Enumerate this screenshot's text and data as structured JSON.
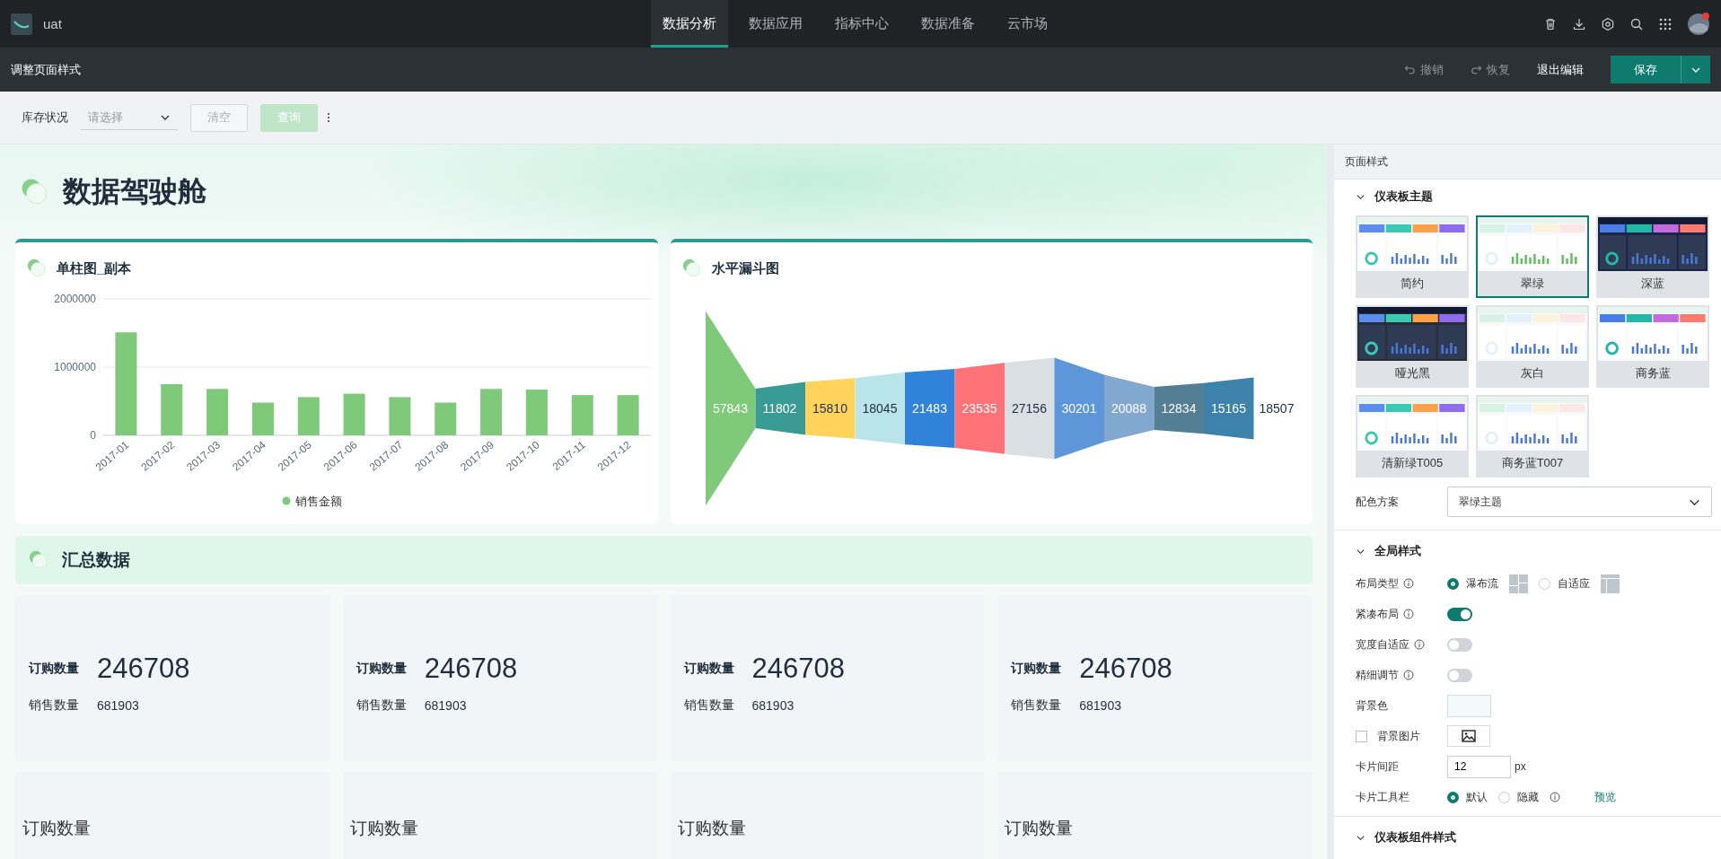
{
  "topbar": {
    "app_name": "uat",
    "nav": [
      {
        "label": "数据分析",
        "selected": true
      },
      {
        "label": "数据应用",
        "selected": false
      },
      {
        "label": "指标中心",
        "selected": false
      },
      {
        "label": "数据准备",
        "selected": false
      },
      {
        "label": "云市场",
        "selected": false
      }
    ]
  },
  "editbar": {
    "title": "调整页面样式",
    "undo": {
      "label": "撤销",
      "disabled": true
    },
    "redo": {
      "label": "恢复",
      "disabled": true
    },
    "exit": "退出编辑",
    "save": "保存"
  },
  "filter": {
    "label": "库存状况",
    "placeholder": "请选择",
    "clear": {
      "label": "清空",
      "disabled": true
    },
    "query": {
      "label": "查询",
      "disabled": true
    }
  },
  "dashboard": {
    "title": "数据驾驶舱",
    "bar_card": {
      "title": "单柱图_副本",
      "chart_data": {
        "type": "bar",
        "categories": [
          "2017-01",
          "2017-02",
          "2017-03",
          "2017-04",
          "2017-05",
          "2017-06",
          "2017-07",
          "2017-08",
          "2017-09",
          "2017-10",
          "2017-11",
          "2017-12"
        ],
        "series": [
          {
            "name": "销售金额",
            "color": "#7ec97a",
            "values": [
              1510000,
              750000,
              680000,
              480000,
              560000,
              610000,
              560000,
              480000,
              680000,
              670000,
              590000,
              590000
            ]
          }
        ],
        "ylim": [
          0,
          2000000
        ],
        "yticks": [
          0,
          1000000,
          2000000
        ]
      }
    },
    "funnel_card": {
      "title": "水平漏斗图",
      "stages": [
        {
          "value": "57843",
          "color": "#7ec97a"
        },
        {
          "value": "11802",
          "color": "#3a9a94"
        },
        {
          "value": "15810",
          "color": "#ffd35c"
        },
        {
          "value": "18045",
          "color": "#b9e5ea"
        },
        {
          "value": "21483",
          "color": "#3182d9"
        },
        {
          "value": "23535",
          "color": "#ff7378"
        },
        {
          "value": "27156",
          "color": "#dadfe3"
        },
        {
          "value": "30201",
          "color": "#5d97d9"
        },
        {
          "value": "20088",
          "color": "#82a8d0"
        },
        {
          "value": "12834",
          "color": "#547e93"
        },
        {
          "value": "15165",
          "color": "#3d82aa"
        },
        {
          "value": "18507"
        }
      ]
    },
    "summary": {
      "title": "汇总数据",
      "cards": [
        {
          "primary_label": "订购数量",
          "primary_value": "246708",
          "secondary_label": "销售数量",
          "secondary_value": "681903"
        },
        {
          "primary_label": "订购数量",
          "primary_value": "246708",
          "secondary_label": "销售数量",
          "secondary_value": "681903"
        },
        {
          "primary_label": "订购数量",
          "primary_value": "246708",
          "secondary_label": "销售数量",
          "secondary_value": "681903"
        },
        {
          "primary_label": "订购数量",
          "primary_value": "246708",
          "secondary_label": "销售数量",
          "secondary_value": "681903"
        }
      ],
      "cards_row_2": [
        {
          "label": "订购数量"
        },
        {
          "label": "订购数量"
        },
        {
          "label": "订购数量"
        },
        {
          "label": "订购数量"
        }
      ]
    }
  },
  "panel": {
    "title": "页面样式",
    "theme_section": {
      "title": "仪表板主题",
      "expanded": true,
      "themes": [
        {
          "label": "简约",
          "selected": false,
          "kind": "light"
        },
        {
          "label": "翠绿",
          "selected": true,
          "kind": "light"
        },
        {
          "label": "深蓝",
          "selected": false,
          "kind": "dark"
        },
        {
          "label": "哑光黑",
          "selected": false,
          "kind": "dark"
        },
        {
          "label": "灰白",
          "selected": false,
          "kind": "light"
        },
        {
          "label": "商务蓝",
          "selected": false,
          "kind": "light"
        },
        {
          "label": "清新绿T005",
          "selected": false,
          "kind": "light"
        },
        {
          "label": "商务蓝T007",
          "selected": false,
          "kind": "light"
        }
      ],
      "scheme": {
        "label": "配色方案",
        "value": "翠绿主题"
      }
    },
    "global_section": {
      "title": "全局样式",
      "expanded": true,
      "layout_type": {
        "label": "布局类型",
        "options": [
          {
            "label": "瀑布流",
            "selected": true
          },
          {
            "label": "自适应",
            "selected": false
          }
        ]
      },
      "toggles": [
        {
          "label": "紧凑布局",
          "on": true
        },
        {
          "label": "宽度自适应",
          "on": false
        },
        {
          "label": "精细调节",
          "on": false
        }
      ],
      "bg_color": {
        "label": "背景色"
      },
      "bg_image": {
        "label": "背景图片",
        "checked": false
      },
      "card_gap": {
        "label": "卡片间距",
        "value": "12",
        "unit": "px"
      },
      "card_toolbar": {
        "label": "卡片工具栏",
        "options": [
          {
            "label": "默认",
            "selected": true
          },
          {
            "label": "隐藏",
            "selected": false
          }
        ],
        "preview": "预览"
      }
    },
    "component_section": {
      "title": "仪表板组件样式",
      "expanded": true
    }
  }
}
